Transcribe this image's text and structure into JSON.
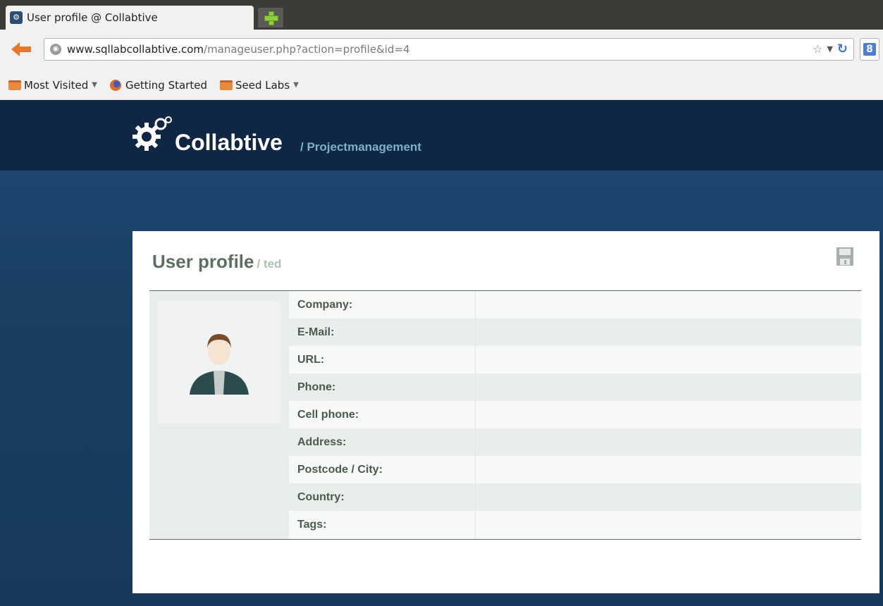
{
  "browser": {
    "tab_title": "User profile @ Collabtive",
    "url_domain": "www.sqllabcollabtive.com",
    "url_path": "/manageuser.php?action=profile&id=4",
    "bookmarks": [
      {
        "label": "Most Visited",
        "icon": "folder-icon"
      },
      {
        "label": "Getting Started",
        "icon": "firefox-icon"
      },
      {
        "label": "Seed Labs",
        "icon": "folder-icon"
      }
    ]
  },
  "app": {
    "name": "Collabtive",
    "subtitle": "/ Projectmanagement"
  },
  "profile": {
    "title": "User profile",
    "username": "/ ted",
    "fields": [
      {
        "label": "Company:",
        "value": ""
      },
      {
        "label": "E-Mail:",
        "value": ""
      },
      {
        "label": "URL:",
        "value": ""
      },
      {
        "label": "Phone:",
        "value": ""
      },
      {
        "label": "Cell phone:",
        "value": ""
      },
      {
        "label": "Address:",
        "value": ""
      },
      {
        "label": "Postcode / City:",
        "value": ""
      },
      {
        "label": "Country:",
        "value": ""
      },
      {
        "label": "Tags:",
        "value": ""
      }
    ]
  },
  "colors": {
    "header_bg": "#0f2744",
    "body_bg": "#1c3f63",
    "title_color": "#5d6f60",
    "accent_light": "#7ab0cc"
  }
}
